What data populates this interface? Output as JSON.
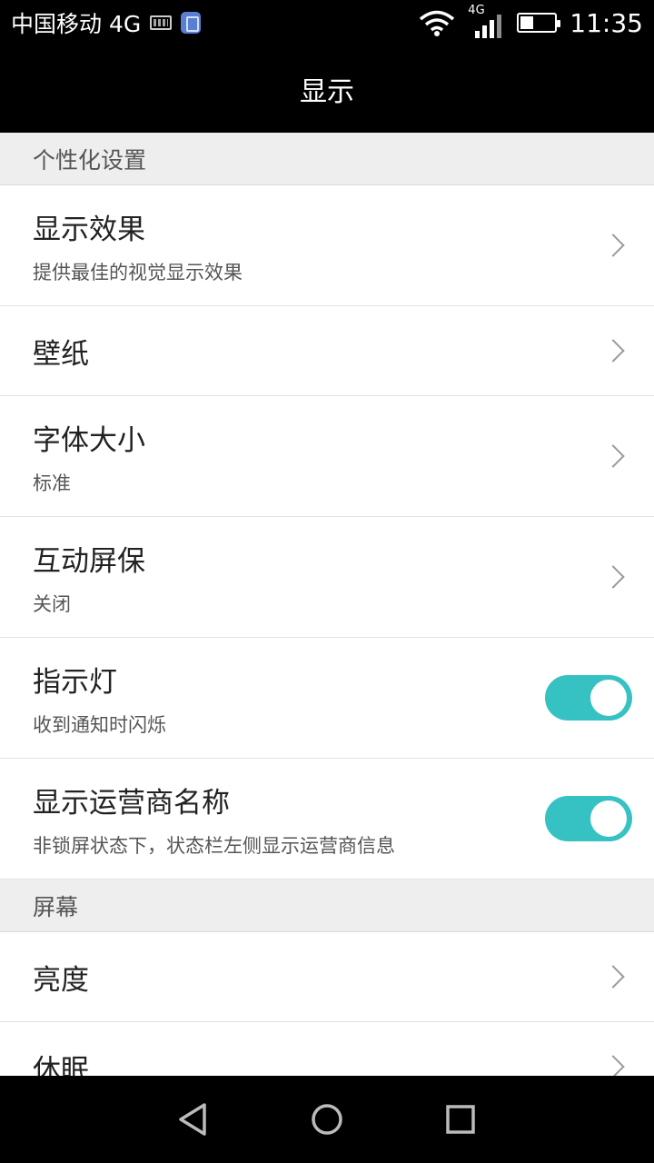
{
  "status_bar": {
    "carrier": "中国移动 4G",
    "network_tag": "4G",
    "time": "11:35",
    "battery_level": 0.4
  },
  "header": {
    "title": "显示"
  },
  "sections": [
    {
      "header": "个性化设置",
      "items": [
        {
          "title": "显示效果",
          "subtitle": "提供最佳的视觉显示效果",
          "control": "chevron"
        },
        {
          "title": "壁纸",
          "subtitle": "",
          "control": "chevron"
        },
        {
          "title": "字体大小",
          "subtitle": "标准",
          "control": "chevron"
        },
        {
          "title": "互动屏保",
          "subtitle": "关闭",
          "control": "chevron"
        },
        {
          "title": "指示灯",
          "subtitle": "收到通知时闪烁",
          "control": "toggle",
          "on": true
        },
        {
          "title": "显示运营商名称",
          "subtitle": "非锁屏状态下，状态栏左侧显示运营商信息",
          "control": "toggle",
          "on": true
        }
      ]
    },
    {
      "header": "屏幕",
      "items": [
        {
          "title": "亮度",
          "subtitle": "",
          "control": "chevron"
        },
        {
          "title": "休眠",
          "subtitle": "",
          "control": "chevron"
        }
      ]
    }
  ],
  "colors": {
    "accent": "#36c2c3",
    "bar_bg": "#000000",
    "section_bg": "#eeeeee"
  },
  "nav_bar": {
    "icons": [
      "back-icon",
      "home-icon",
      "recents-icon"
    ]
  }
}
